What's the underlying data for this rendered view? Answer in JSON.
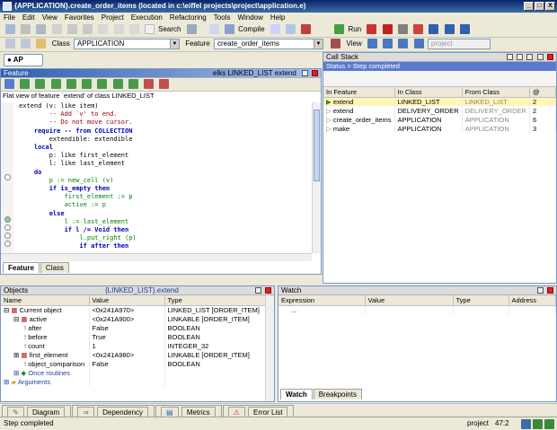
{
  "window": {
    "title": "{APPLICATION}.create_order_items (located in c:\\eiffel projects\\project\\application.e)",
    "controls": [
      "_",
      "□",
      "X"
    ]
  },
  "menu": [
    "File",
    "Edit",
    "View",
    "Favorites",
    "Project",
    "Execution",
    "Refactoring",
    "Tools",
    "Window",
    "Help"
  ],
  "toolbar": {
    "search_label": "Search",
    "compile_label": "Compile",
    "run_label": "Run",
    "class_label": "Class",
    "class_value": "APPLICATION",
    "feature_label": "Feature",
    "feature_value": "create_order_items",
    "view_label": "View",
    "view_value": "project"
  },
  "feature_panel": {
    "title": "Feature",
    "context": "elks  LINKED_LIST  extend",
    "flat_view_text": "Flat view of feature `extend' of class LINKED_LIST",
    "tabs": [
      "Feature",
      "Class"
    ]
  },
  "code_lines": [
    {
      "t": "extend (v: like item)",
      "k": "sig"
    },
    {
      "t": "        -- Add `v' to end.",
      "k": "cm"
    },
    {
      "t": "        -- Do not move cursor.",
      "k": "cm"
    },
    {
      "t": "    require -- from COLLECTION",
      "k": "req"
    },
    {
      "t": "        extendible: extendible",
      "k": "plain"
    },
    {
      "t": "    local",
      "k": "kw"
    },
    {
      "t": "        p: like first_element",
      "k": "plain"
    },
    {
      "t": "        l: like last_element",
      "k": "plain"
    },
    {
      "t": "    do",
      "k": "kw"
    },
    {
      "t": "        p := new_cell (v)",
      "k": "gr"
    },
    {
      "t": "        if is_empty then",
      "k": "if"
    },
    {
      "t": "            first_element := p",
      "k": "gr"
    },
    {
      "t": "            active := p",
      "k": "gr"
    },
    {
      "t": "        else",
      "k": "kw"
    },
    {
      "t": "            l := last_element",
      "k": "gr"
    },
    {
      "t": "            if l /= Void then",
      "k": "if"
    },
    {
      "t": "                l.put_right (p)",
      "k": "gr"
    },
    {
      "t": "                if after then",
      "k": "if"
    }
  ],
  "callstack": {
    "title": "Call Stack",
    "status": "Status = Step completed",
    "headers": [
      "In Feature",
      "In Class",
      "From Class",
      "@"
    ],
    "rows": [
      {
        "feature": "extend",
        "in_class": "LINKED_LIST",
        "from_class": "LINKED_LIST",
        "at": "2"
      },
      {
        "feature": "extend",
        "in_class": "DELIVERY_ORDER",
        "from_class": "DELIVERY_ORDER",
        "at": "2"
      },
      {
        "feature": "create_order_items",
        "in_class": "APPLICATION",
        "from_class": "APPLICATION",
        "at": "6"
      },
      {
        "feature": "make",
        "in_class": "APPLICATION",
        "from_class": "APPLICATION",
        "at": "3"
      }
    ]
  },
  "objects": {
    "title": "Objects",
    "context": "{LINKED_LIST}.extend",
    "headers": [
      "Name",
      "Value",
      "Type"
    ],
    "rows": [
      {
        "name": "Current object",
        "value": "<0x241A970>",
        "type": "LINKED_LIST [ORDER_ITEM]",
        "indent": 0
      },
      {
        "name": "active",
        "value": "<0x241A900>",
        "type": "LINKABLE [ORDER_ITEM]",
        "indent": 1
      },
      {
        "name": "after",
        "value": "False",
        "type": "BOOLEAN",
        "indent": 2
      },
      {
        "name": "before",
        "value": "True",
        "type": "BOOLEAN",
        "indent": 2
      },
      {
        "name": "count",
        "value": "1",
        "type": "INTEGER_32",
        "indent": 2
      },
      {
        "name": "first_element",
        "value": "<0x241A980>",
        "type": "LINKABLE [ORDER_ITEM]",
        "indent": 1
      },
      {
        "name": "object_comparison",
        "value": "False",
        "type": "BOOLEAN",
        "indent": 2
      },
      {
        "name": "Once routines",
        "value": "",
        "type": "",
        "indent": 1
      },
      {
        "name": "Arguments",
        "value": "",
        "type": "",
        "indent": 0
      }
    ]
  },
  "watch": {
    "title": "Watch",
    "headers": [
      "Expression",
      "Value",
      "Type",
      "Address"
    ],
    "placeholder_row": "...",
    "tabs": [
      "Watch",
      "Breakpoints"
    ]
  },
  "bottom_tabs": [
    "Diagram",
    "Dependency",
    "Metrics",
    "Error List"
  ],
  "statusbar": {
    "message": "Step completed",
    "project": "project",
    "position": "47:2"
  }
}
